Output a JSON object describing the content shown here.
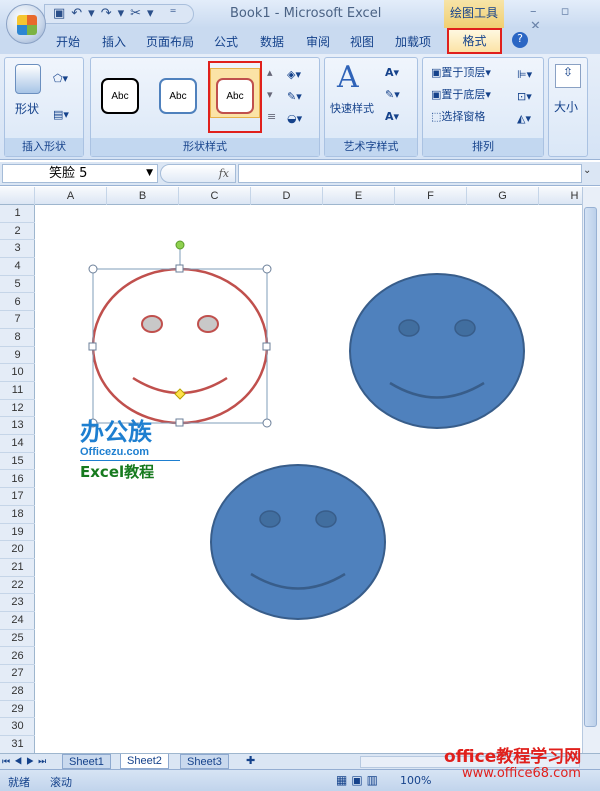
{
  "window": {
    "title": "Book1 - Microsoft Excel",
    "context_tab": "绘图工具",
    "controls": "– ▫ ✕"
  },
  "qat": {
    "icons": [
      "save-icon",
      "undo-icon",
      "redo-icon",
      "tools-icon",
      "customize-icon"
    ],
    "text": "▣↶▾↷▾✂▾ ⁼"
  },
  "tabs": [
    "开始",
    "插入",
    "页面布局",
    "公式",
    "数据",
    "审阅",
    "视图",
    "加载项",
    "格式"
  ],
  "ribbon": {
    "insert_shapes": {
      "label": "插入形状",
      "shapes_button": "形状"
    },
    "shape_styles": {
      "label": "形状样式",
      "styles": [
        "Abc",
        "Abc",
        "Abc"
      ],
      "colors": [
        "#000000",
        "#4f81bd",
        "#c0504d"
      ],
      "selected": 2
    },
    "wordart": {
      "label": "艺术字样式",
      "quick_styles": "快速样式"
    },
    "arrange": {
      "label": "排列",
      "bring_front": "置于顶层",
      "send_back": "置于底层",
      "selection_pane": "选择窗格"
    },
    "size": {
      "label": "大小"
    }
  },
  "formula_bar": {
    "name_box": "笑脸 5",
    "fx": "fx",
    "value": ""
  },
  "columns": [
    "A",
    "B",
    "C",
    "D",
    "E",
    "F",
    "G",
    "H"
  ],
  "rows": [
    "1",
    "2",
    "3",
    "4",
    "5",
    "6",
    "7",
    "8",
    "9",
    "10",
    "11",
    "12",
    "13",
    "14",
    "15",
    "16",
    "17",
    "18",
    "19",
    "20",
    "21",
    "22",
    "23",
    "24",
    "25",
    "26",
    "27",
    "28",
    "29",
    "30",
    "31"
  ],
  "shapes": [
    {
      "name": "笑脸 5",
      "selected": true,
      "outline": "#c0504d",
      "fill": "none"
    },
    {
      "fill": "#4f81bd",
      "outline": "#385d8a"
    },
    {
      "fill": "#4f81bd",
      "outline": "#385d8a"
    }
  ],
  "logo": {
    "title": "办公族",
    "site": "Officezu.com",
    "subtitle": "Excel教程"
  },
  "sheets": [
    "Sheet1",
    "Sheet2",
    "Sheet3"
  ],
  "active_sheet": "Sheet2",
  "status": {
    "ready": "就绪",
    "scroll": "滚动",
    "zoom": "100%"
  },
  "watermark": {
    "line1": "office教程学习网",
    "line2": "www.office68.com"
  }
}
